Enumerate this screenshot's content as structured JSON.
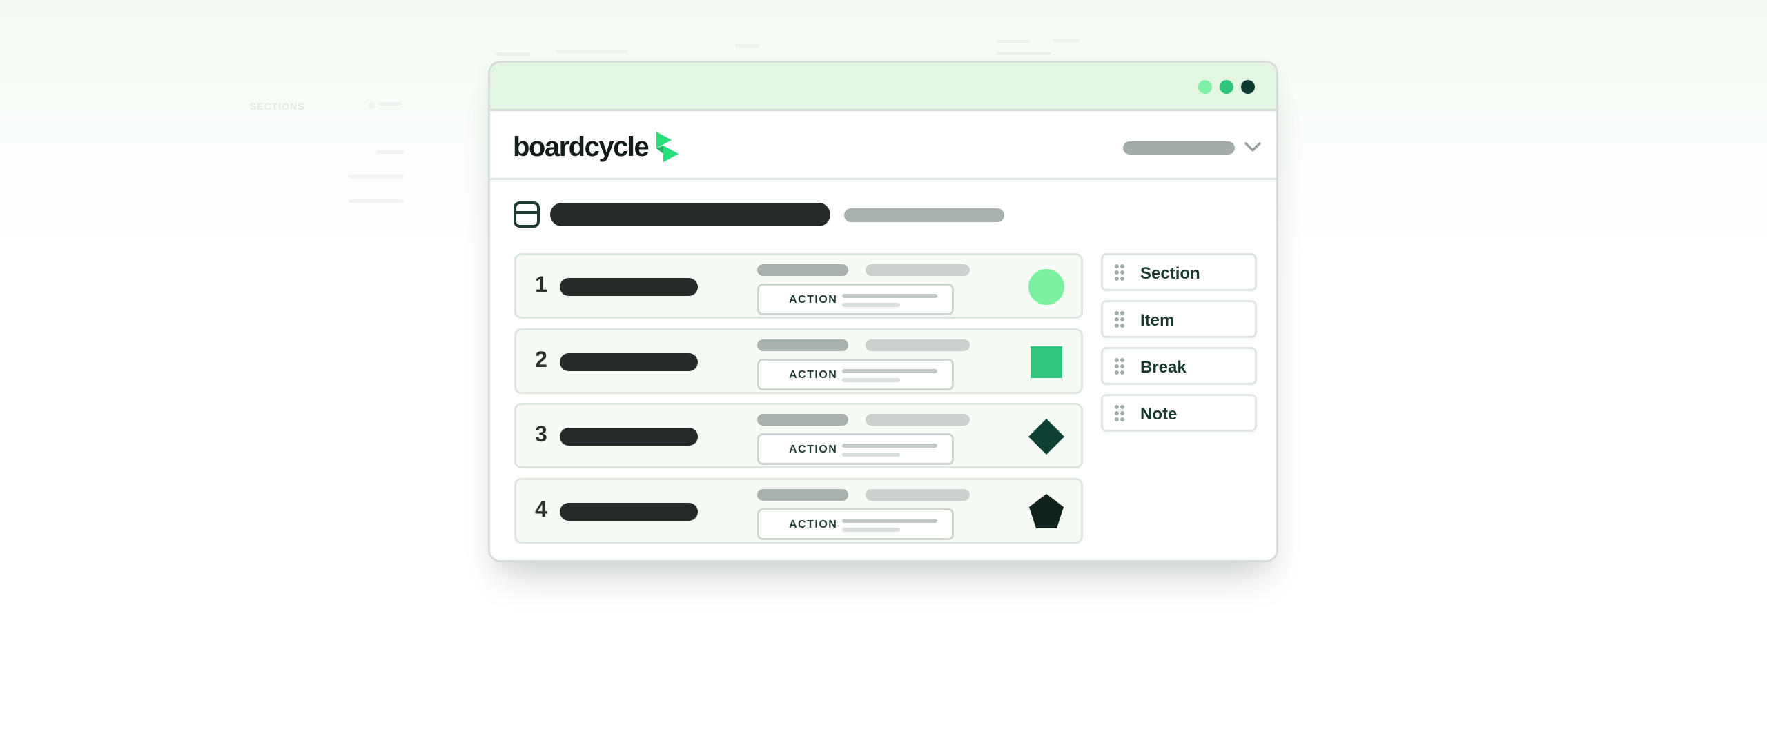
{
  "background_ghost": {
    "sections_label": "SECTIONS"
  },
  "window": {
    "controls": [
      {
        "name": "light-green",
        "color": "#7ff0a5"
      },
      {
        "name": "mid-green",
        "color": "#2ec47c"
      },
      {
        "name": "dark-green",
        "color": "#0e3b30"
      }
    ]
  },
  "header": {
    "logo_text": "boardcycle",
    "logo_icon": "boardcycle-mark-icon",
    "account_icon": "chevron-down-icon"
  },
  "page": {
    "icon": "layout-panel-icon"
  },
  "agenda": {
    "rows": [
      {
        "number": "1",
        "action_label": "ACTION",
        "shape": "circle",
        "shape_color": "#7ef0a2"
      },
      {
        "number": "2",
        "action_label": "ACTION",
        "shape": "square",
        "shape_color": "#2ec57c"
      },
      {
        "number": "3",
        "action_label": "ACTION",
        "shape": "diamond",
        "shape_color": "#0d3f32"
      },
      {
        "number": "4",
        "action_label": "ACTION",
        "shape": "pentagon",
        "shape_color": "#0f231c"
      }
    ]
  },
  "palette": {
    "items": [
      {
        "label": "Section",
        "icon": "drag-handle-icon"
      },
      {
        "label": "Item",
        "icon": "drag-handle-icon"
      },
      {
        "label": "Break",
        "icon": "drag-handle-icon"
      },
      {
        "label": "Note",
        "icon": "drag-handle-icon"
      }
    ]
  },
  "colors": {
    "brand_green": "#27e07a",
    "brand_dark": "#141c18",
    "titlebar_bg": "#e3f6e2"
  }
}
